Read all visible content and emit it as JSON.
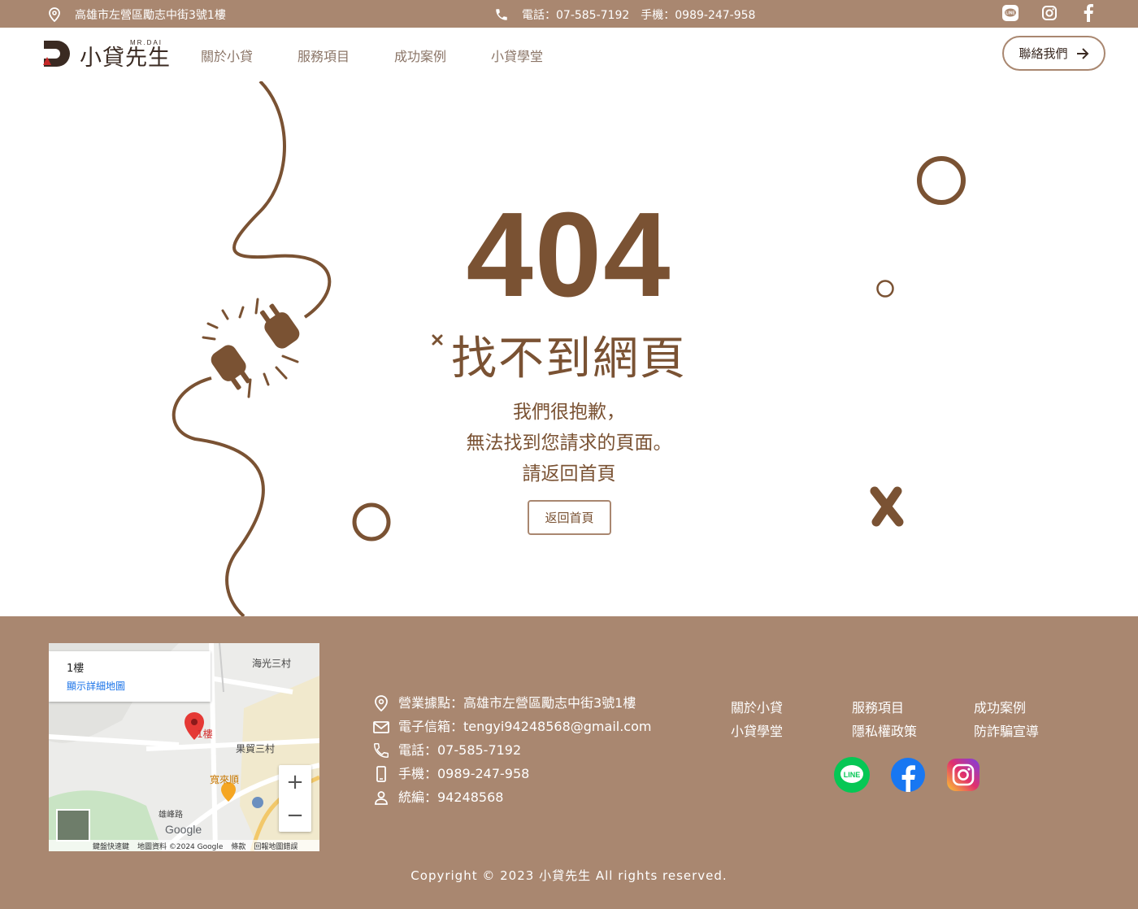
{
  "topbar": {
    "address": "高雄市左營區勵志中街3號1樓",
    "phone_line": "電話：07-585-7192　手機：0989-247-958",
    "social_icons": [
      "line-icon",
      "instagram-icon",
      "facebook-icon"
    ]
  },
  "header": {
    "logo_text": "小貸先生",
    "logo_sub": "MR.DAI",
    "nav": [
      "關於小貸",
      "服務項目",
      "成功案例",
      "小貸學堂"
    ],
    "contact_label": "聯絡我們"
  },
  "main": {
    "code": "404",
    "title": "找不到網頁",
    "message_lines": [
      "我們很抱歉，",
      "無法找到您請求的頁面。",
      "請返回首頁"
    ],
    "back_label": "返回首頁"
  },
  "footer": {
    "map": {
      "place": "1樓",
      "details_link": "顯示詳細地圖",
      "labels": [
        "海光三村",
        "1樓",
        "果貿三村",
        "寬來順",
        "雄峰路",
        "Google"
      ],
      "footer_links": [
        "鍵盤快速鍵",
        "地圖資料 ©2024 Google",
        "條款",
        "回報地圖錯誤"
      ]
    },
    "info": [
      {
        "icon": "location-icon",
        "text": "營業據點：高雄市左營區勵志中街3號1樓"
      },
      {
        "icon": "mail-icon",
        "text": "電子信箱：tengyi94248568@gmail.com"
      },
      {
        "icon": "phone-icon",
        "text": "電話：07-585-7192"
      },
      {
        "icon": "mobile-icon",
        "text": "手機：0989-247-958"
      },
      {
        "icon": "person-icon",
        "text": "統編：94248568"
      }
    ],
    "links_col1": [
      "關於小貸",
      "小貸學堂"
    ],
    "links_col2": [
      "服務項目",
      "隱私權政策"
    ],
    "links_col3": [
      "成功案例",
      "防詐騙宣導"
    ],
    "copyright": "Copyright © 2023 小貸先生 All rights reserved."
  },
  "colors": {
    "brand_brown": "#7a5233",
    "bar_brown": "#a98770",
    "line_green": "#06c755",
    "facebook_blue": "#1877f2"
  }
}
